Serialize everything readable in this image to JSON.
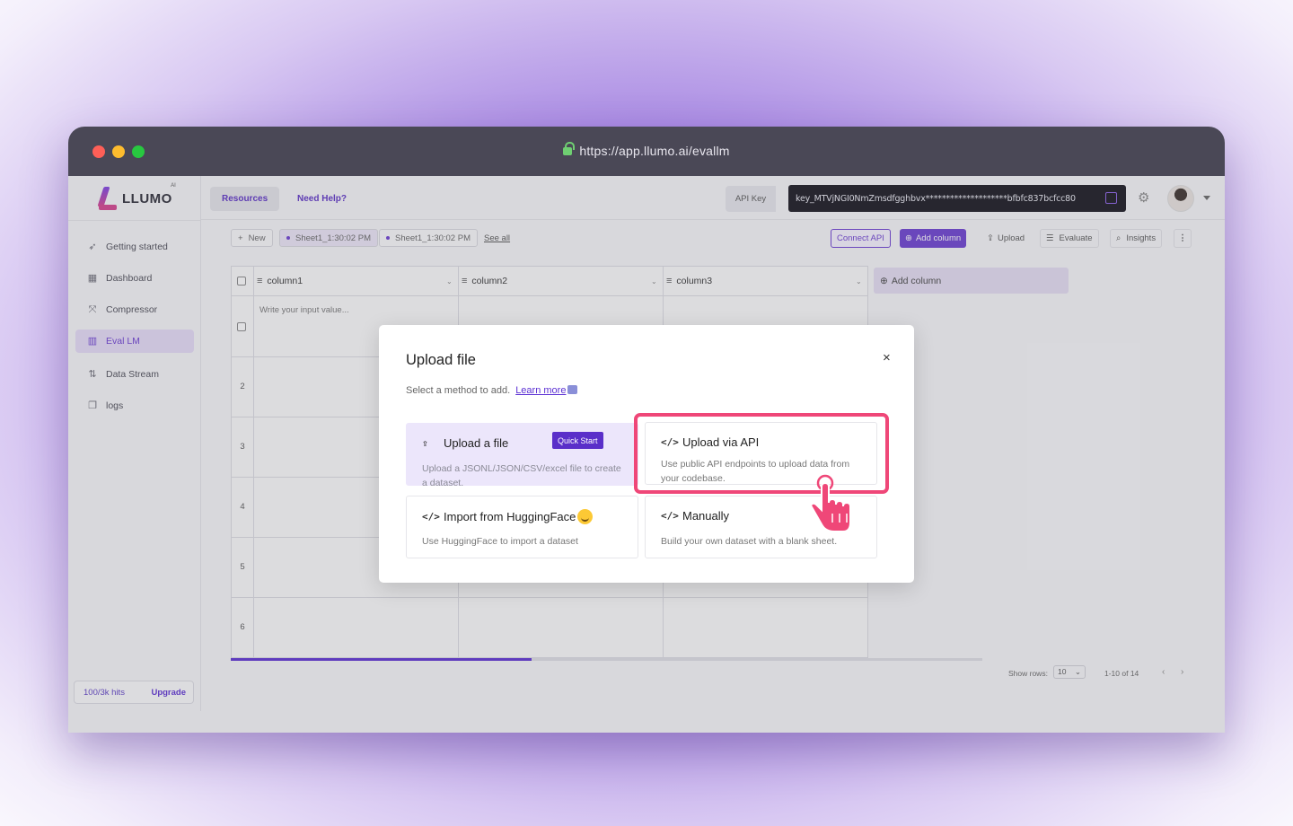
{
  "browser": {
    "url": "https://app.llumo.ai/evallm"
  },
  "logo": {
    "text": "LLUMO",
    "badge": "AI"
  },
  "sidebar": {
    "items": [
      {
        "label": "Getting started",
        "icon": "rocket-icon"
      },
      {
        "label": "Dashboard",
        "icon": "grid-icon"
      },
      {
        "label": "Compressor",
        "icon": "compress-icon"
      },
      {
        "label": "Eval LM",
        "icon": "chart-icon",
        "active": true
      },
      {
        "label": "Data Stream",
        "icon": "flow-icon"
      },
      {
        "label": "logs",
        "icon": "log-icon"
      }
    ],
    "hits": "100/3k hits",
    "upgrade": "Upgrade"
  },
  "topbar": {
    "resources": "Resources",
    "help": "Need Help?",
    "api_key_label": "API Key",
    "api_key_value": "key_MTVjNGI0NmZmsdfgghbvx********************bfbfc837bcfcc80"
  },
  "toolbar": {
    "new": "New",
    "sheets": [
      "Sheet1_1:30:02 PM",
      "Sheet1_1:30:02 PM"
    ],
    "see_all": "See all",
    "connect_api": "Connect API",
    "add_column": "Add column",
    "upload": "Upload",
    "evaluate": "Evaluate",
    "insights": "Insights",
    "more": "⋮"
  },
  "grid": {
    "columns": [
      "column1",
      "column2",
      "column3"
    ],
    "placeholder": "Write your input value...",
    "row_numbers": [
      "2",
      "3",
      "4",
      "5",
      "6"
    ],
    "add_column": "Add column",
    "progress": 0.4
  },
  "footer": {
    "show_rows_label": "Show rows:",
    "rows_value": "10",
    "range": "1-10 of 14"
  },
  "modal": {
    "title": "Upload file",
    "subtitle": "Select a method to add.",
    "learn_more": "Learn more",
    "close": "×",
    "options": {
      "file": {
        "title": "Upload a file",
        "badge": "Quick Start",
        "desc": "Upload a JSONL/JSON/CSV/excel file to create a dataset."
      },
      "api": {
        "title": "Upload via API",
        "desc": "Use public API endpoints to upload data from your codebase."
      },
      "hf": {
        "title": "Import from HuggingFace",
        "desc": "Use HuggingFace to import a dataset"
      },
      "manual": {
        "title": "Manually",
        "desc": "Build your own dataset with a blank sheet."
      }
    }
  },
  "colors": {
    "accent": "#5b2fd3",
    "highlight": "#ef4778",
    "modal_bg": "#ffffff"
  }
}
